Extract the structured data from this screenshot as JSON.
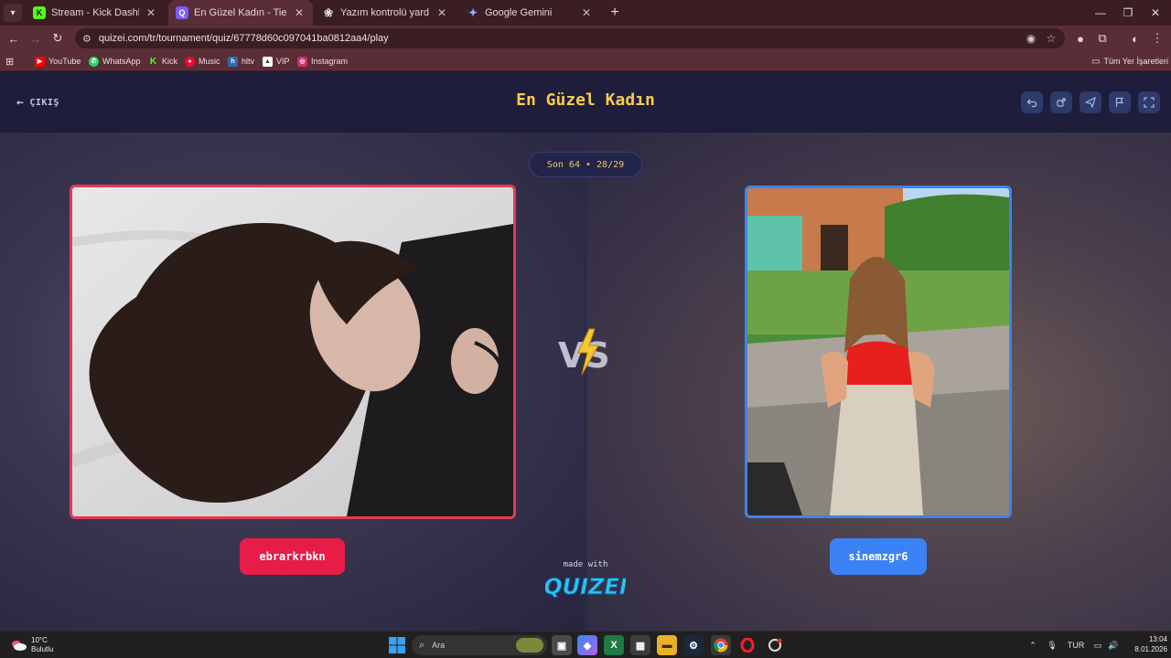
{
  "browser": {
    "tabs": [
      {
        "title": "Stream - Kick Dashboard",
        "favicon": "kick-icon",
        "color": "#53fc18",
        "active": false
      },
      {
        "title": "En Güzel Kadın - Tier List, Kör S",
        "favicon": "quizei-icon",
        "color": "#7a5cff",
        "active": true
      },
      {
        "title": "Yazım kontrolü yardımı",
        "favicon": "openai-icon",
        "color": "#e0e0e0",
        "active": false
      },
      {
        "title": "Google Gemini",
        "favicon": "gemini-icon",
        "color": "#8ab4f8",
        "active": false
      }
    ],
    "url": "quizei.com/tr/tournament/quiz/67778d60c097041ba0812aa4/play",
    "bookmarks": [
      {
        "label": "YouTube",
        "icon": "youtube-icon",
        "color": "#ff0000"
      },
      {
        "label": "WhatsApp",
        "icon": "whatsapp-icon",
        "color": "#25d366"
      },
      {
        "label": "Kick",
        "icon": "kick-icon",
        "color": "#53fc18"
      },
      {
        "label": "Music",
        "icon": "music-icon",
        "color": "#ff0033"
      },
      {
        "label": "hltv",
        "icon": "hltv-icon",
        "color": "#2b6ea6"
      },
      {
        "label": "VIP",
        "icon": "vip-icon",
        "color": "#ffffff"
      },
      {
        "label": "Instagram",
        "icon": "instagram-icon",
        "color": "#d62976"
      }
    ],
    "all_bookmarks_label": "Tüm Yer İşaretleri"
  },
  "quiz": {
    "exit_label": "ÇIKIŞ",
    "title": "En Güzel Kadın",
    "round_text": "Son 64 • 28/29",
    "left": {
      "name": "ebrarkrbkn",
      "accent": "#e61d47"
    },
    "right": {
      "name": "sinemzgr6",
      "accent": "#3b82f6"
    },
    "made_with": "made with",
    "brand": "QUIZEI"
  },
  "taskbar": {
    "weather_temp": "10°C",
    "weather_desc": "Bulutlu",
    "search_placeholder": "Ara",
    "language": "TUR",
    "time": "13:04",
    "date": "8.01.2026"
  }
}
